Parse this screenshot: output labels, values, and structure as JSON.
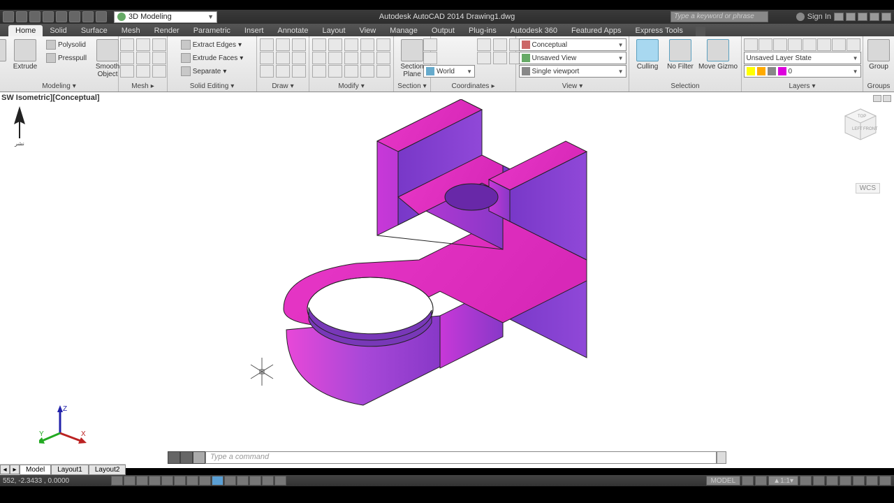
{
  "title": "Autodesk AutoCAD 2014   Drawing1.dwg",
  "workspace": "3D Modeling",
  "search_placeholder": "Type a keyword or phrase",
  "signin": "Sign In",
  "tabs": [
    "Home",
    "Solid",
    "Surface",
    "Mesh",
    "Render",
    "Parametric",
    "Insert",
    "Annotate",
    "Layout",
    "View",
    "Manage",
    "Output",
    "Plug-ins",
    "Autodesk 360",
    "Featured Apps",
    "Express Tools"
  ],
  "active_tab": 0,
  "ribbon": {
    "modeling": {
      "label": "Modeling",
      "extrude": "Extrude",
      "polysolid": "Polysolid",
      "presspull": "Presspull",
      "smooth": "Smooth\nObject"
    },
    "mesh": {
      "label": "Mesh"
    },
    "solidedit": {
      "label": "Solid Editing",
      "extract": "Extract Edges",
      "faces": "Extrude Faces",
      "separate": "Separate"
    },
    "draw": {
      "label": "Draw"
    },
    "modify": {
      "label": "Modify"
    },
    "section": {
      "label": "Section",
      "plane": "Section\nPlane"
    },
    "coords": {
      "label": "Coordinates",
      "world": "World"
    },
    "view": {
      "label": "View",
      "visual": "Conceptual",
      "unsaved": "Unsaved View",
      "viewport": "Single viewport"
    },
    "selection": {
      "label": "Selection",
      "culling": "Culling",
      "nofilter": "No Filter",
      "gizmo": "Move Gizmo"
    },
    "layers": {
      "label": "Layers",
      "state": "Unsaved Layer State",
      "current": "0"
    },
    "groups": {
      "label": "Groups",
      "group": "Group"
    }
  },
  "viewport_label": "SW Isometric][Conceptual]",
  "wcs_label": "WCS",
  "command_placeholder": "Type a command",
  "layout_tabs": [
    "Model",
    "Layout1",
    "Layout2"
  ],
  "active_layout": 0,
  "coords_readout": "552, -2.3433 , 0.0000",
  "model_badge": "MODEL",
  "scale": "1:1",
  "axes": {
    "x": "X",
    "y": "Y",
    "z": "Z"
  }
}
